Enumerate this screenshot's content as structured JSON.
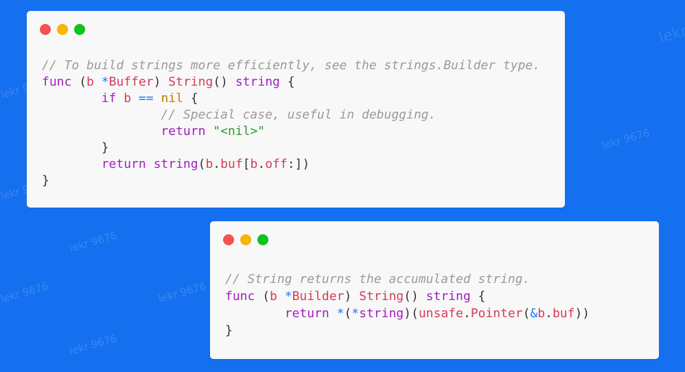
{
  "colors": {
    "background": "#1570ef",
    "card": "#f8f8f8",
    "red": "#f45151",
    "yellow": "#f7b500",
    "green": "#10c21f",
    "comment": "#9a9a9a",
    "keyword": "#a11fbf",
    "identifier": "#d63b57",
    "operator": "#1d79ff",
    "string": "#2d9a2d",
    "nil": "#c17d00"
  },
  "watermark": {
    "text": "lekr 9676",
    "big_text": "lekr"
  },
  "windows": [
    {
      "traffic_lights": [
        "close",
        "minimize",
        "maximize"
      ],
      "lines": [
        [
          {
            "t": "// To build strings more efficiently, see the strings.Builder type.",
            "k": "comment"
          }
        ],
        [
          {
            "t": "func",
            "k": "keyword"
          },
          {
            "t": " ",
            "k": "punc"
          },
          {
            "t": "(",
            "k": "punc"
          },
          {
            "t": "b",
            "k": "ident"
          },
          {
            "t": " ",
            "k": "punc"
          },
          {
            "t": "*",
            "k": "op"
          },
          {
            "t": "Buffer",
            "k": "ident"
          },
          {
            "t": ") ",
            "k": "punc"
          },
          {
            "t": "String",
            "k": "func"
          },
          {
            "t": "() ",
            "k": "punc"
          },
          {
            "t": "string",
            "k": "type"
          },
          {
            "t": " {",
            "k": "punc"
          }
        ],
        [
          {
            "t": "        ",
            "k": "punc"
          },
          {
            "t": "if",
            "k": "keyword"
          },
          {
            "t": " ",
            "k": "punc"
          },
          {
            "t": "b",
            "k": "ident"
          },
          {
            "t": " ",
            "k": "punc"
          },
          {
            "t": "==",
            "k": "op"
          },
          {
            "t": " ",
            "k": "punc"
          },
          {
            "t": "nil",
            "k": "nil"
          },
          {
            "t": " {",
            "k": "punc"
          }
        ],
        [
          {
            "t": "                ",
            "k": "punc"
          },
          {
            "t": "// Special case, useful in debugging.",
            "k": "comment"
          }
        ],
        [
          {
            "t": "                ",
            "k": "punc"
          },
          {
            "t": "return",
            "k": "keyword"
          },
          {
            "t": " ",
            "k": "punc"
          },
          {
            "t": "\"<nil>\"",
            "k": "string"
          }
        ],
        [
          {
            "t": "        }",
            "k": "punc"
          }
        ],
        [
          {
            "t": "        ",
            "k": "punc"
          },
          {
            "t": "return",
            "k": "keyword"
          },
          {
            "t": " ",
            "k": "punc"
          },
          {
            "t": "string",
            "k": "type"
          },
          {
            "t": "(",
            "k": "punc"
          },
          {
            "t": "b",
            "k": "ident"
          },
          {
            "t": ".",
            "k": "punc"
          },
          {
            "t": "buf",
            "k": "ident"
          },
          {
            "t": "[",
            "k": "punc"
          },
          {
            "t": "b",
            "k": "ident"
          },
          {
            "t": ".",
            "k": "punc"
          },
          {
            "t": "off",
            "k": "ident"
          },
          {
            "t": ":])",
            "k": "punc"
          }
        ],
        [
          {
            "t": "}",
            "k": "punc"
          }
        ]
      ]
    },
    {
      "traffic_lights": [
        "close",
        "minimize",
        "maximize"
      ],
      "lines": [
        [
          {
            "t": "// String returns the accumulated string.",
            "k": "comment"
          }
        ],
        [
          {
            "t": "func",
            "k": "keyword"
          },
          {
            "t": " ",
            "k": "punc"
          },
          {
            "t": "(",
            "k": "punc"
          },
          {
            "t": "b",
            "k": "ident"
          },
          {
            "t": " ",
            "k": "punc"
          },
          {
            "t": "*",
            "k": "op"
          },
          {
            "t": "Builder",
            "k": "ident"
          },
          {
            "t": ") ",
            "k": "punc"
          },
          {
            "t": "String",
            "k": "func"
          },
          {
            "t": "() ",
            "k": "punc"
          },
          {
            "t": "string",
            "k": "type"
          },
          {
            "t": " {",
            "k": "punc"
          }
        ],
        [
          {
            "t": "        ",
            "k": "punc"
          },
          {
            "t": "return",
            "k": "keyword"
          },
          {
            "t": " ",
            "k": "punc"
          },
          {
            "t": "*",
            "k": "op"
          },
          {
            "t": "(",
            "k": "punc"
          },
          {
            "t": "*",
            "k": "op"
          },
          {
            "t": "string",
            "k": "type"
          },
          {
            "t": ")(",
            "k": "punc"
          },
          {
            "t": "unsafe",
            "k": "ident"
          },
          {
            "t": ".",
            "k": "punc"
          },
          {
            "t": "Pointer",
            "k": "ident"
          },
          {
            "t": "(",
            "k": "punc"
          },
          {
            "t": "&",
            "k": "op"
          },
          {
            "t": "b",
            "k": "ident"
          },
          {
            "t": ".",
            "k": "punc"
          },
          {
            "t": "buf",
            "k": "ident"
          },
          {
            "t": "))",
            "k": "punc"
          }
        ],
        [
          {
            "t": "}",
            "k": "punc"
          }
        ]
      ]
    }
  ]
}
